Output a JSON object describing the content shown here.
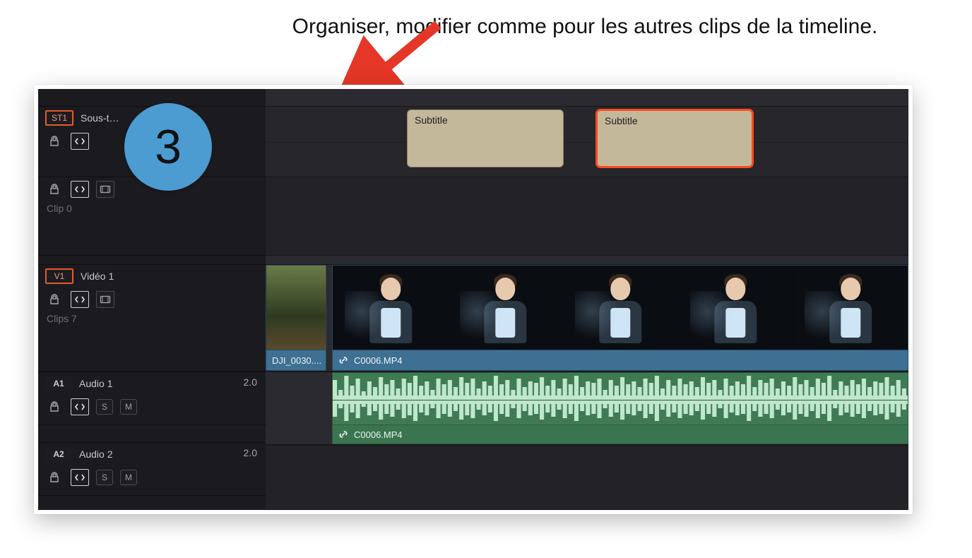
{
  "annotation": {
    "text": "Organiser, modifier comme pour les autres clips de la timeline.",
    "step_number": "3"
  },
  "tracks": {
    "subtitle": {
      "tag": "ST1",
      "name": "Sous-t…",
      "clips": [
        {
          "label": "Subtitle"
        },
        {
          "label": "Subtitle"
        }
      ]
    },
    "spacer": {
      "sub": "Clip 0"
    },
    "video1": {
      "tag": "V1",
      "name": "Vidéo 1",
      "sub": "Clips 7",
      "clips": [
        {
          "label": "DJI_0030...."
        },
        {
          "label": "C0006.MP4"
        }
      ]
    },
    "audio1": {
      "tag": "A1",
      "name": "Audio 1",
      "level": "2.0",
      "clip_label": "C0006.MP4",
      "solo": "S",
      "mute": "M"
    },
    "audio2": {
      "tag": "A2",
      "name": "Audio 2",
      "level": "2.0",
      "solo": "S",
      "mute": "M"
    }
  }
}
